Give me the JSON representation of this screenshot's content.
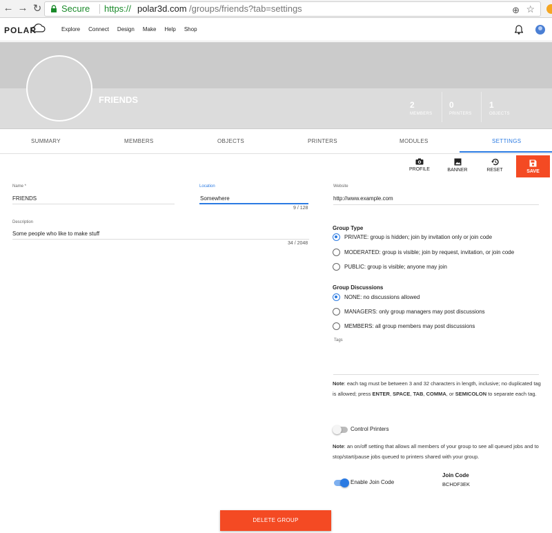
{
  "browser": {
    "secure_label": "Secure",
    "url_proto": "https://",
    "url_host": "polar3d.com",
    "url_path": "/groups/friends?tab=settings"
  },
  "header": {
    "logo": "POLAR",
    "nav": [
      "Explore",
      "Connect",
      "Design",
      "Make",
      "Help",
      "Shop"
    ]
  },
  "group": {
    "name": "FRIENDS",
    "stats": [
      {
        "value": "2",
        "label": "MEMBERS"
      },
      {
        "value": "0",
        "label": "PRINTERS"
      },
      {
        "value": "1",
        "label": "OBJECTS"
      }
    ]
  },
  "tabs": [
    "SUMMARY",
    "MEMBERS",
    "OBJECTS",
    "PRINTERS",
    "MODULES",
    "SETTINGS"
  ],
  "actions": {
    "profile": "PROFILE",
    "banner": "BANNER",
    "reset": "RESET",
    "save": "SAVE"
  },
  "form": {
    "name": {
      "label": "Name *",
      "value": "FRIENDS"
    },
    "location": {
      "label": "Location",
      "value": "Somewhere",
      "counter": "9 / 128"
    },
    "website": {
      "label": "Website",
      "value": "http://www.example.com"
    },
    "description": {
      "label": "Description",
      "value": "Some people who like to make stuff",
      "counter": "34 / 2048"
    },
    "tags": {
      "label": "Tags"
    }
  },
  "group_type": {
    "title": "Group Type",
    "options": [
      {
        "label": "PRIVATE: group is hidden; join by invitation only or join code",
        "selected": true
      },
      {
        "label": "MODERATED: group is visible; join by request, invitation, or join code",
        "selected": false
      },
      {
        "label": "PUBLIC: group is visible; anyone may join",
        "selected": false
      }
    ]
  },
  "group_discussions": {
    "title": "Group Discussions",
    "options": [
      {
        "label": "NONE: no discussions allowed",
        "selected": true
      },
      {
        "label": "MANAGERS: only group managers may post discussions",
        "selected": false
      },
      {
        "label": "MEMBERS: all group members may post discussions",
        "selected": false
      }
    ]
  },
  "tag_note": {
    "prefix": "Note",
    "text1": ": each tag must be between 3 and 32 characters in length, inclusive; no duplicated tag is allowed; press ",
    "k1": "ENTER",
    "c1": ", ",
    "k2": "SPACE",
    "c2": ", ",
    "k3": "TAB",
    "c3": ", ",
    "k4": "COMMA",
    "c4": ", or ",
    "k5": "SEMICOLON",
    "text2": " to separate each tag."
  },
  "control_printers": {
    "label": "Control Printers",
    "enabled": false,
    "note_prefix": "Note",
    "note_text": ": an on/off setting that allows all members of your group to see all queued jobs and to stop/start/pause jobs queued to printers shared with your group."
  },
  "join_code": {
    "toggle_label": "Enable Join Code",
    "enabled": true,
    "title": "Join Code",
    "value": "BCHDF3EK"
  },
  "delete_label": "DELETE GROUP",
  "colors": {
    "accent": "#2a7ae2",
    "danger": "#f44a23",
    "secure": "#1a8a2a"
  }
}
